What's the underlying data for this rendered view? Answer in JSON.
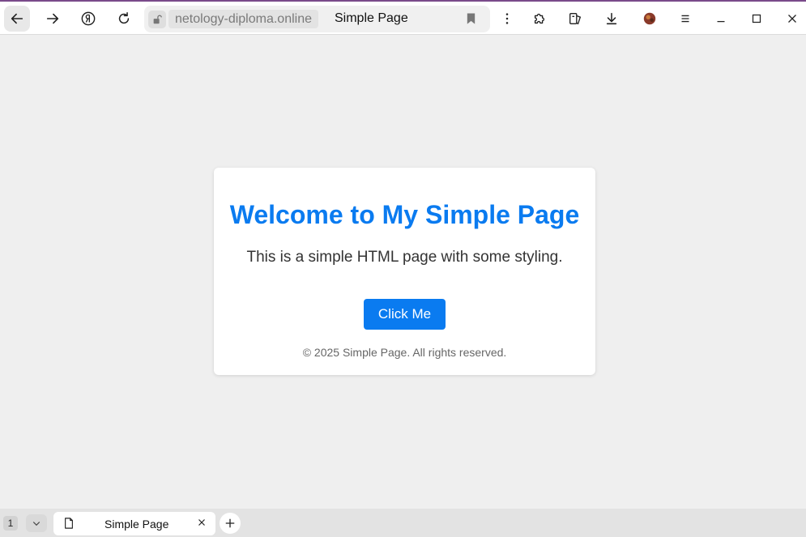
{
  "browser": {
    "address_domain": "netology-diploma.online",
    "address_title": "Simple Page"
  },
  "page": {
    "heading": "Welcome to My Simple Page",
    "lead": "This is a simple HTML page with some styling.",
    "button_label": "Click Me",
    "footer": "© 2025 Simple Page. All rights reserved."
  },
  "tabs": {
    "count": "1",
    "items": [
      {
        "title": "Simple Page"
      }
    ]
  },
  "colors": {
    "accent": "#0a7bf0",
    "background": "#efefef"
  }
}
